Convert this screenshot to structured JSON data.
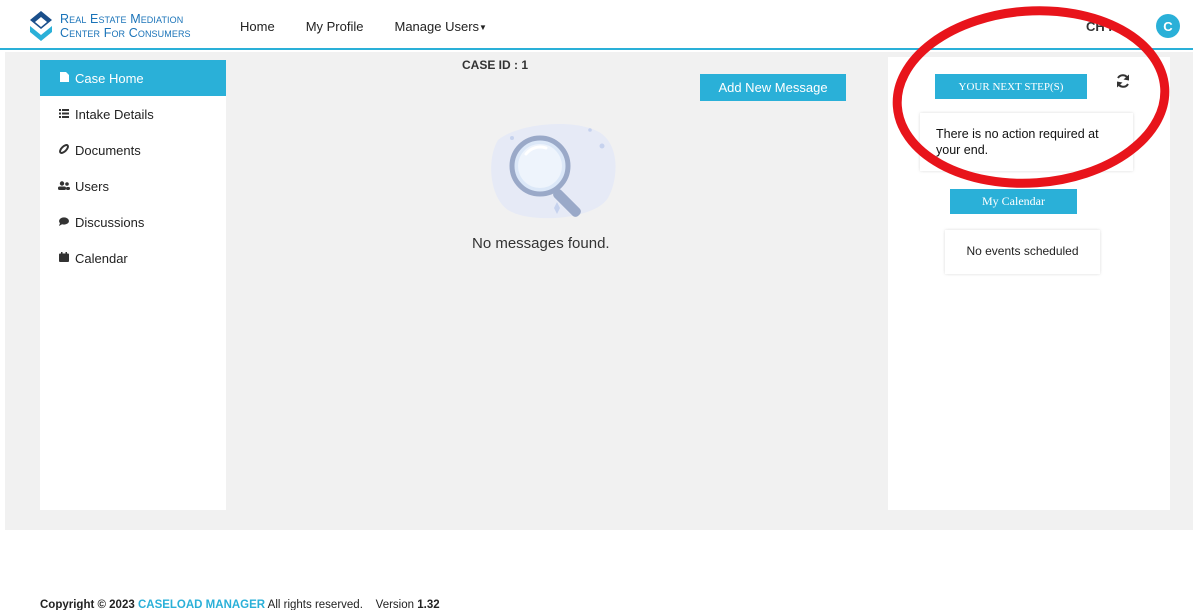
{
  "header": {
    "logo_line1": "Real Estate Mediation",
    "logo_line2": "Center For Consumers",
    "nav": [
      "Home",
      "My Profile",
      "Manage Users"
    ],
    "user_name": "CH R",
    "avatar_letter": "C"
  },
  "sidebar": {
    "items": [
      {
        "label": "Case Home",
        "icon": "file-icon"
      },
      {
        "label": "Intake Details",
        "icon": "list-icon"
      },
      {
        "label": "Documents",
        "icon": "paperclip-icon"
      },
      {
        "label": "Users",
        "icon": "users-icon"
      },
      {
        "label": "Discussions",
        "icon": "chat-icon"
      },
      {
        "label": "Calendar",
        "icon": "calendar-icon"
      }
    ],
    "active_index": 0
  },
  "main": {
    "case_id": "CASE ID : 1",
    "add_message_label": "Add New Message",
    "empty_message": "No messages found."
  },
  "right_panel": {
    "next_step_label": "YOUR NEXT STEP(S)",
    "action_text": "There is no action required at your end.",
    "calendar_label": "My Calendar",
    "events_text": "No events scheduled"
  },
  "footer": {
    "copyright_prefix": "Copyright © 2023",
    "brand": "CASELOAD MANAGER",
    "rights": "All rights reserved.",
    "version_label": "Version",
    "version_number": "1.32"
  },
  "colors": {
    "accent": "#2ab0d8",
    "annotation": "#e8141b",
    "background": "#f1f1f1"
  }
}
